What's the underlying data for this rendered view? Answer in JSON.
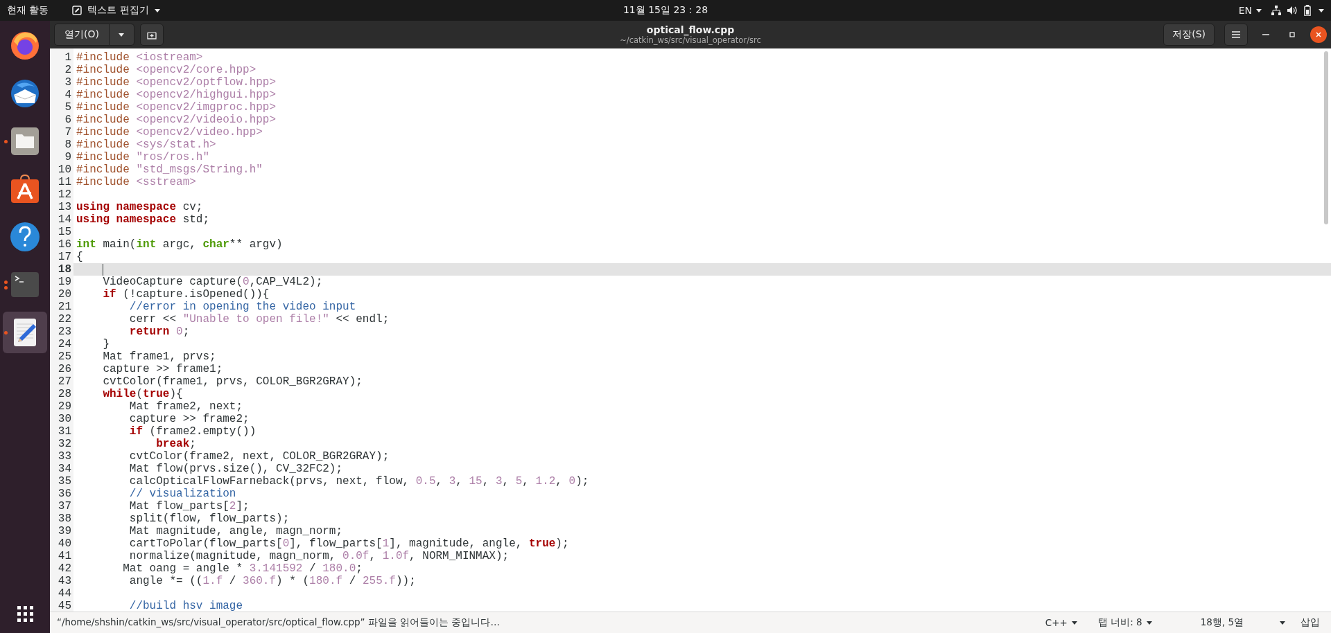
{
  "top_bar": {
    "activities": "현재 활동",
    "app_menu": "텍스트 편집기",
    "clock": "11월 15일  23：28",
    "input_source": "EN"
  },
  "dock": {
    "items": [
      {
        "kind": "browser",
        "running": false,
        "multiple_windows": false,
        "selected": false
      },
      {
        "kind": "mail",
        "running": false,
        "multiple_windows": false,
        "selected": false
      },
      {
        "kind": "files",
        "running": true,
        "multiple_windows": false,
        "selected": false
      },
      {
        "kind": "software",
        "running": false,
        "multiple_windows": false,
        "selected": false
      },
      {
        "kind": "help",
        "running": false,
        "multiple_windows": false,
        "selected": false
      },
      {
        "kind": "terminal",
        "running": true,
        "multiple_windows": true,
        "selected": false
      },
      {
        "kind": "editor",
        "running": true,
        "multiple_windows": false,
        "selected": true
      }
    ]
  },
  "header": {
    "open_button": "열기(O)",
    "title": "optical_flow.cpp",
    "subtitle": "~/catkin_ws/src/visual_operator/src",
    "save_button": "저장(S)"
  },
  "editor": {
    "lines": [
      {
        "number": "1",
        "current": false,
        "tokens": [
          {
            "kind": "pre",
            "text": "#include "
          },
          {
            "kind": "str",
            "text": "<iostream>"
          }
        ]
      },
      {
        "number": "2",
        "current": false,
        "tokens": [
          {
            "kind": "pre",
            "text": "#include "
          },
          {
            "kind": "str",
            "text": "<opencv2/core.hpp>"
          }
        ]
      },
      {
        "number": "3",
        "current": false,
        "tokens": [
          {
            "kind": "pre",
            "text": "#include "
          },
          {
            "kind": "str",
            "text": "<opencv2/optflow.hpp>"
          }
        ]
      },
      {
        "number": "4",
        "current": false,
        "tokens": [
          {
            "kind": "pre",
            "text": "#include "
          },
          {
            "kind": "str",
            "text": "<opencv2/highgui.hpp>"
          }
        ]
      },
      {
        "number": "5",
        "current": false,
        "tokens": [
          {
            "kind": "pre",
            "text": "#include "
          },
          {
            "kind": "str",
            "text": "<opencv2/imgproc.hpp>"
          }
        ]
      },
      {
        "number": "6",
        "current": false,
        "tokens": [
          {
            "kind": "pre",
            "text": "#include "
          },
          {
            "kind": "str",
            "text": "<opencv2/videoio.hpp>"
          }
        ]
      },
      {
        "number": "7",
        "current": false,
        "tokens": [
          {
            "kind": "pre",
            "text": "#include "
          },
          {
            "kind": "str",
            "text": "<opencv2/video.hpp>"
          }
        ]
      },
      {
        "number": "8",
        "current": false,
        "tokens": [
          {
            "kind": "pre",
            "text": "#include "
          },
          {
            "kind": "str",
            "text": "<sys/stat.h>"
          }
        ]
      },
      {
        "number": "9",
        "current": false,
        "tokens": [
          {
            "kind": "pre",
            "text": "#include "
          },
          {
            "kind": "str",
            "text": "\"ros/ros.h\""
          }
        ]
      },
      {
        "number": "10",
        "current": false,
        "tokens": [
          {
            "kind": "pre",
            "text": "#include "
          },
          {
            "kind": "str",
            "text": "\"std_msgs/String.h\""
          }
        ]
      },
      {
        "number": "11",
        "current": false,
        "tokens": [
          {
            "kind": "pre",
            "text": "#include "
          },
          {
            "kind": "str",
            "text": "<sstream>"
          }
        ]
      },
      {
        "number": "12",
        "current": false
      },
      {
        "number": "13",
        "current": false,
        "tokens": [
          {
            "kind": "kw",
            "text": "using namespace"
          },
          {
            "kind": "txt",
            "text": " cv;"
          }
        ]
      },
      {
        "number": "14",
        "current": false,
        "tokens": [
          {
            "kind": "kw",
            "text": "using namespace"
          },
          {
            "kind": "txt",
            "text": " std;"
          }
        ]
      },
      {
        "number": "15",
        "current": false
      },
      {
        "number": "16",
        "current": false,
        "tokens": [
          {
            "kind": "type",
            "text": "int"
          },
          {
            "kind": "txt",
            "text": " main("
          },
          {
            "kind": "type",
            "text": "int"
          },
          {
            "kind": "txt",
            "text": " argc, "
          },
          {
            "kind": "type",
            "text": "char"
          },
          {
            "kind": "txt",
            "text": "** argv)"
          }
        ]
      },
      {
        "number": "17",
        "current": false,
        "tokens": [
          {
            "kind": "txt",
            "text": "{"
          }
        ]
      },
      {
        "number": "18",
        "current": true
      },
      {
        "number": "19",
        "current": false,
        "tokens": [
          {
            "kind": "txt",
            "text": "    VideoCapture capture("
          },
          {
            "kind": "num",
            "text": "0"
          },
          {
            "kind": "txt",
            "text": ",CAP_V4L2);"
          }
        ]
      },
      {
        "number": "20",
        "current": false,
        "tokens": [
          {
            "kind": "kw",
            "text": "    if"
          },
          {
            "kind": "txt",
            "text": " (!capture.isOpened()){"
          }
        ]
      },
      {
        "number": "21",
        "current": false,
        "tokens": [
          {
            "kind": "com",
            "text": "        //error in opening the video input"
          }
        ]
      },
      {
        "number": "22",
        "current": false,
        "tokens": [
          {
            "kind": "txt",
            "text": "        cerr << "
          },
          {
            "kind": "str",
            "text": "\"Unable to open file!\""
          },
          {
            "kind": "txt",
            "text": " << endl;"
          }
        ]
      },
      {
        "number": "23",
        "current": false,
        "tokens": [
          {
            "kind": "kw",
            "text": "        return"
          },
          {
            "kind": "num",
            "text": " 0"
          },
          {
            "kind": "txt",
            "text": ";"
          }
        ]
      },
      {
        "number": "24",
        "current": false,
        "tokens": [
          {
            "kind": "txt",
            "text": "    }"
          }
        ]
      },
      {
        "number": "25",
        "current": false,
        "tokens": [
          {
            "kind": "txt",
            "text": "    Mat frame1, prvs;"
          }
        ]
      },
      {
        "number": "26",
        "current": false,
        "tokens": [
          {
            "kind": "txt",
            "text": "    capture >> frame1;"
          }
        ]
      },
      {
        "number": "27",
        "current": false,
        "tokens": [
          {
            "kind": "txt",
            "text": "    cvtColor(frame1, prvs, COLOR_BGR2GRAY);"
          }
        ]
      },
      {
        "number": "28",
        "current": false,
        "tokens": [
          {
            "kind": "kw",
            "text": "    while"
          },
          {
            "kind": "txt",
            "text": "("
          },
          {
            "kind": "kw",
            "text": "true"
          },
          {
            "kind": "txt",
            "text": "){"
          }
        ]
      },
      {
        "number": "29",
        "current": false,
        "tokens": [
          {
            "kind": "txt",
            "text": "        Mat frame2, next;"
          }
        ]
      },
      {
        "number": "30",
        "current": false,
        "tokens": [
          {
            "kind": "txt",
            "text": "        capture >> frame2;"
          }
        ]
      },
      {
        "number": "31",
        "current": false,
        "tokens": [
          {
            "kind": "kw",
            "text": "        if"
          },
          {
            "kind": "txt",
            "text": " (frame2.empty())"
          }
        ]
      },
      {
        "number": "32",
        "current": false,
        "tokens": [
          {
            "kind": "kw",
            "text": "            break"
          },
          {
            "kind": "txt",
            "text": ";"
          }
        ]
      },
      {
        "number": "33",
        "current": false,
        "tokens": [
          {
            "kind": "txt",
            "text": "        cvtColor(frame2, next, COLOR_BGR2GRAY);"
          }
        ]
      },
      {
        "number": "34",
        "current": false,
        "tokens": [
          {
            "kind": "txt",
            "text": "        Mat flow(prvs.size(), CV_32FC2);"
          }
        ]
      },
      {
        "number": "35",
        "current": false,
        "tokens": [
          {
            "kind": "txt",
            "text": "        calcOpticalFlowFarneback(prvs, next, flow, "
          },
          {
            "kind": "num",
            "text": "0.5"
          },
          {
            "kind": "txt",
            "text": ", "
          },
          {
            "kind": "num",
            "text": "3"
          },
          {
            "kind": "txt",
            "text": ", "
          },
          {
            "kind": "num",
            "text": "15"
          },
          {
            "kind": "txt",
            "text": ", "
          },
          {
            "kind": "num",
            "text": "3"
          },
          {
            "kind": "txt",
            "text": ", "
          },
          {
            "kind": "num",
            "text": "5"
          },
          {
            "kind": "txt",
            "text": ", "
          },
          {
            "kind": "num",
            "text": "1.2"
          },
          {
            "kind": "txt",
            "text": ", "
          },
          {
            "kind": "num",
            "text": "0"
          },
          {
            "kind": "txt",
            "text": ");"
          }
        ]
      },
      {
        "number": "36",
        "current": false,
        "tokens": [
          {
            "kind": "com",
            "text": "        // visualization"
          }
        ]
      },
      {
        "number": "37",
        "current": false,
        "tokens": [
          {
            "kind": "txt",
            "text": "        Mat flow_parts["
          },
          {
            "kind": "num",
            "text": "2"
          },
          {
            "kind": "txt",
            "text": "];"
          }
        ]
      },
      {
        "number": "38",
        "current": false,
        "tokens": [
          {
            "kind": "txt",
            "text": "        split(flow, flow_parts);"
          }
        ]
      },
      {
        "number": "39",
        "current": false,
        "tokens": [
          {
            "kind": "txt",
            "text": "        Mat magnitude, angle, magn_norm;"
          }
        ]
      },
      {
        "number": "40",
        "current": false,
        "tokens": [
          {
            "kind": "txt",
            "text": "        cartToPolar(flow_parts["
          },
          {
            "kind": "num",
            "text": "0"
          },
          {
            "kind": "txt",
            "text": "], flow_parts["
          },
          {
            "kind": "num",
            "text": "1"
          },
          {
            "kind": "txt",
            "text": "], magnitude, angle, "
          },
          {
            "kind": "kw",
            "text": "true"
          },
          {
            "kind": "txt",
            "text": ");"
          }
        ]
      },
      {
        "number": "41",
        "current": false,
        "tokens": [
          {
            "kind": "txt",
            "text": "        normalize(magnitude, magn_norm, "
          },
          {
            "kind": "num",
            "text": "0.0f"
          },
          {
            "kind": "txt",
            "text": ", "
          },
          {
            "kind": "num",
            "text": "1.0f"
          },
          {
            "kind": "txt",
            "text": ", NORM_MINMAX);"
          }
        ]
      },
      {
        "number": "42",
        "current": false,
        "tokens": [
          {
            "kind": "txt",
            "text": "       Mat oang = angle * "
          },
          {
            "kind": "num",
            "text": "3.141592"
          },
          {
            "kind": "txt",
            "text": " / "
          },
          {
            "kind": "num",
            "text": "180.0"
          },
          {
            "kind": "txt",
            "text": ";"
          }
        ]
      },
      {
        "number": "43",
        "current": false,
        "tokens": [
          {
            "kind": "txt",
            "text": "        angle *= (("
          },
          {
            "kind": "num",
            "text": "1.f"
          },
          {
            "kind": "txt",
            "text": " / "
          },
          {
            "kind": "num",
            "text": "360.f"
          },
          {
            "kind": "txt",
            "text": ") * ("
          },
          {
            "kind": "num",
            "text": "180.f"
          },
          {
            "kind": "txt",
            "text": " / "
          },
          {
            "kind": "num",
            "text": "255.f"
          },
          {
            "kind": "txt",
            "text": "));"
          }
        ]
      },
      {
        "number": "44",
        "current": false
      },
      {
        "number": "45",
        "current": false,
        "tokens": [
          {
            "kind": "com",
            "text": "        //build hsv image"
          }
        ]
      }
    ]
  },
  "status_bar": {
    "message": "“/home/shshin/catkin_ws/src/visual_operator/src/optical_flow.cpp” 파일을 읽어들이는 중입니다…",
    "language": "C++",
    "tab_width": "탭 너비: 8",
    "position": "18행, 5열",
    "mode": "삽입"
  }
}
